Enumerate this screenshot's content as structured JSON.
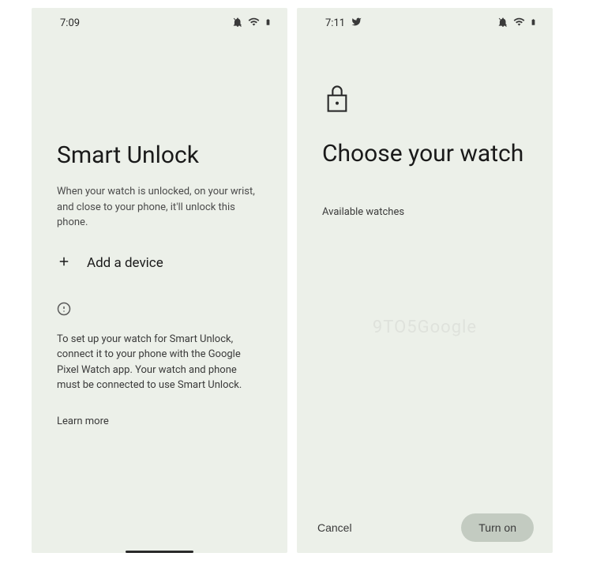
{
  "screen1": {
    "time": "7:09",
    "title": "Smart Unlock",
    "description": "When your watch is unlocked, on your wrist, and close to your phone, it'll unlock this phone.",
    "add_device_label": "Add a device",
    "info_text": "To set up your watch for Smart Unlock, connect it to your phone with the Google Pixel Watch app. Your watch and phone must be connected to use Smart Unlock.",
    "learn_more": "Learn more"
  },
  "screen2": {
    "time": "7:11",
    "title": "Choose your watch",
    "section_label": "Available watches",
    "watermark": "9TO5Google",
    "cancel_label": "Cancel",
    "confirm_label": "Turn on"
  }
}
